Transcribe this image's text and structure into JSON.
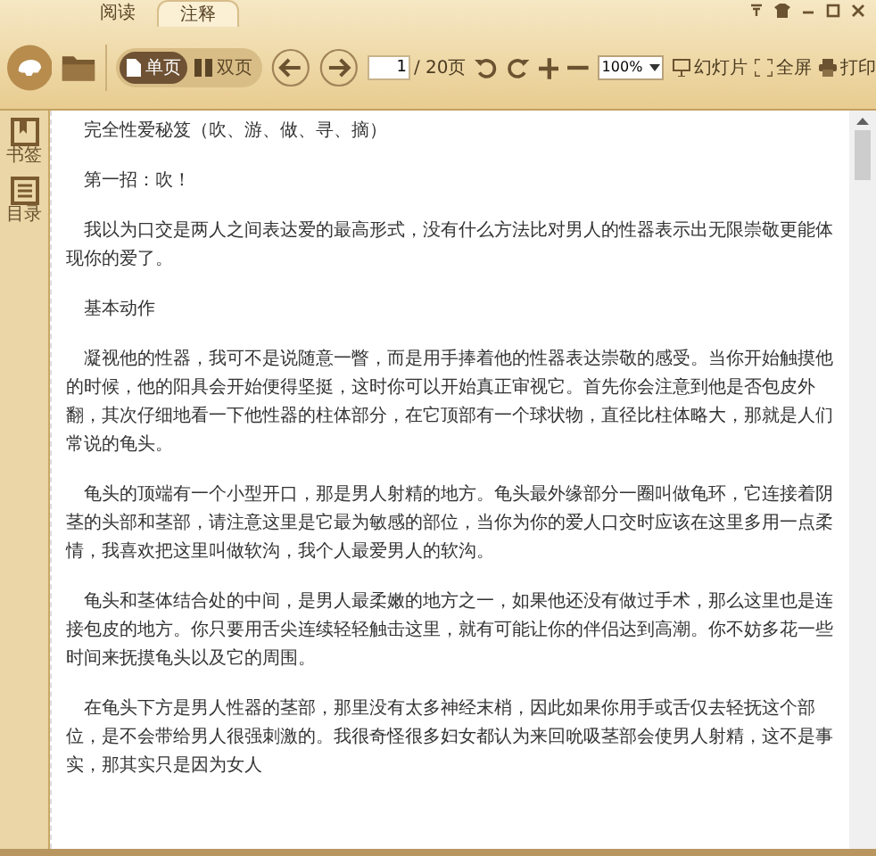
{
  "tabs": [
    {
      "label": "阅读",
      "selected": false
    },
    {
      "label": "注释",
      "selected": true
    }
  ],
  "toolbar": {
    "view_modes": [
      {
        "label": "单页",
        "kind": "single",
        "selected": true
      },
      {
        "label": "双页",
        "kind": "double",
        "selected": false
      }
    ],
    "page_input": {
      "value": "1"
    },
    "page_total": "/ 20页",
    "zoom": {
      "value": "100%"
    },
    "buttons": [
      {
        "kind": "slideshow",
        "label": "幻灯片"
      },
      {
        "kind": "fullscreen",
        "label": "全屏"
      },
      {
        "kind": "print",
        "label": "打印"
      }
    ]
  },
  "sidebar": {
    "items": [
      {
        "kind": "bookmark",
        "label": "书签"
      },
      {
        "kind": "toc",
        "label": "目录"
      }
    ]
  },
  "document": {
    "paragraphs": [
      "完全性爱秘笈（吹、游、做、寻、摘）",
      "第一招：吹！",
      "我以为口交是两人之间表达爱的最高形式，没有什么方法比对男人的性器表示出无限崇敬更能体现你的爱了。",
      "基本动作",
      "凝视他的性器，我可不是说随意一瞥，而是用手捧着他的性器表达崇敬的感受。当你开始触摸他的时候，他的阳具会开始便得坚挺，这时你可以开始真正审视它。首先你会注意到他是否包皮外翻，其次仔细地看一下他性器的柱体部分，在它顶部有一个球状物，直径比柱体略大，那就是人们常说的龟头。",
      "龟头的顶端有一个小型开口，那是男人射精的地方。龟头最外缘部分一圈叫做龟环，它连接着阴茎的头部和茎部，请注意这里是它最为敏感的部位，当你为你的爱人口交时应该在这里多用一点柔情，我喜欢把这里叫做软沟，我个人最爱男人的软沟。",
      "龟头和茎体结合处的中间，是男人最柔嫩的地方之一，如果他还没有做过手术，那么这里也是连接包皮的地方。你只要用舌尖连续轻轻触击这里，就有可能让你的伴侣达到高潮。你不妨多花一些时间来抚摸龟头以及它的周围。",
      "在龟头下方是男人性器的茎部，那里没有太多神经末梢，因此如果你用手或舌仅去轻抚这个部位，是不会带给男人很强刺激的。我很奇怪很多妇女都认为来回吮吸茎部会使男人射精，这不是事实，那其实只是因为女人"
    ]
  }
}
